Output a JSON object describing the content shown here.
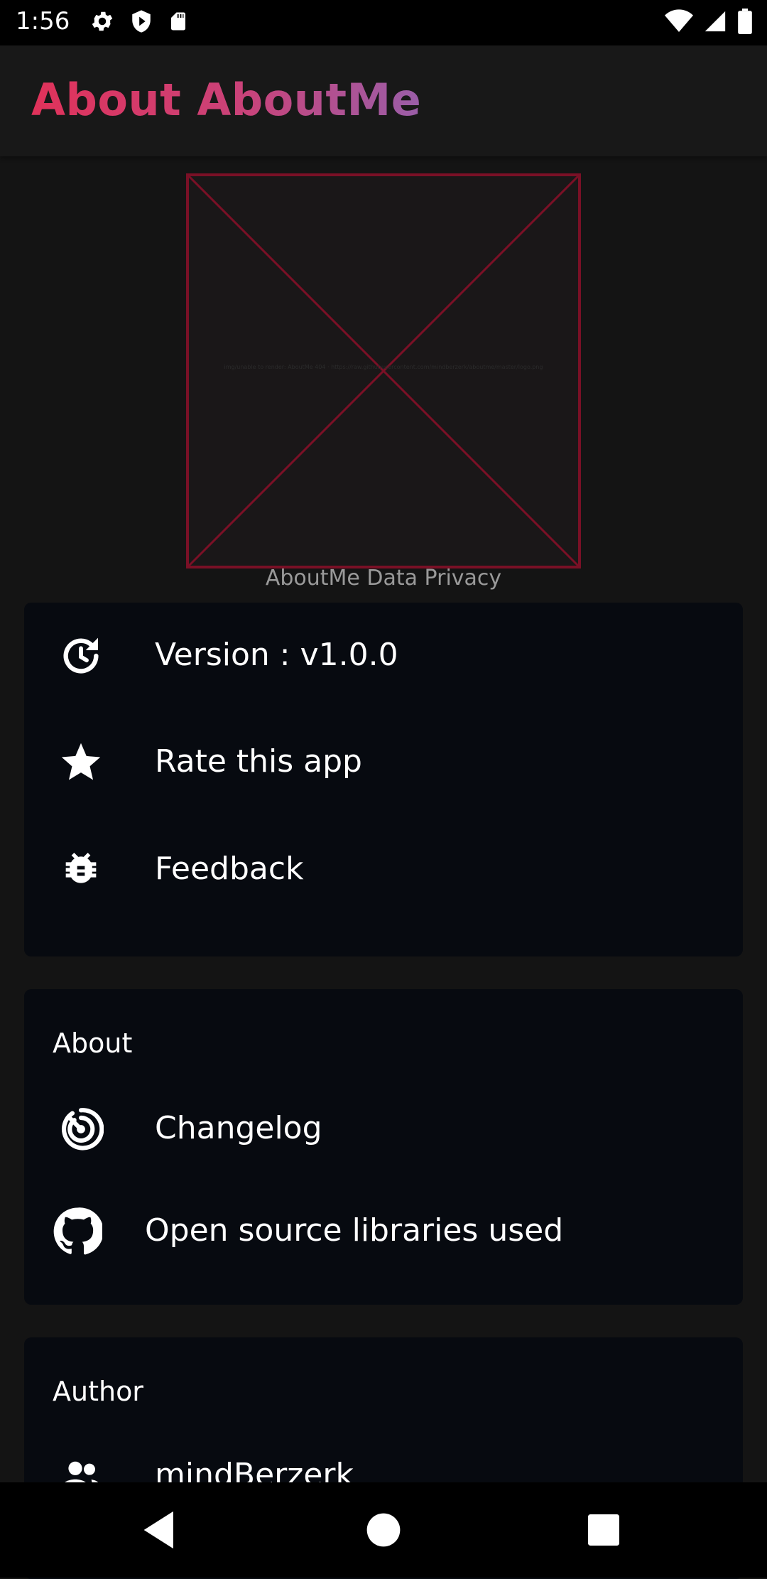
{
  "status_bar": {
    "time": "1:56",
    "left_icons": [
      "gear-icon",
      "shield-play-icon",
      "sd-card-icon"
    ],
    "right_icons": [
      "wifi-icon",
      "signal-icon",
      "battery-icon"
    ]
  },
  "app_bar": {
    "title": "About AboutMe",
    "title_gradient": [
      "#e0325a",
      "#9a5ea8"
    ]
  },
  "header": {
    "logo_alt": "img/unable to render: AboutMe 404 · https://raw.githubusercontent.com/mindberzerk/aboutme/master/logo.png",
    "privacy_link": "AboutMe Data Privacy"
  },
  "info_card": {
    "items": [
      {
        "icon": "update-icon",
        "label": "Version : v1.0.0"
      },
      {
        "icon": "star-icon",
        "label": "Rate this app"
      },
      {
        "icon": "bug-icon",
        "label": "Feedback"
      }
    ]
  },
  "about_card": {
    "title": "About",
    "items": [
      {
        "icon": "changelog-icon",
        "label": "Changelog"
      },
      {
        "icon": "github-icon",
        "label": "Open source libraries used"
      }
    ]
  },
  "author_card": {
    "title": "Author",
    "items": [
      {
        "icon": "people-icon",
        "label": "mindBerzerk"
      }
    ]
  },
  "nav_bar": {
    "buttons": [
      "back-icon",
      "home-icon",
      "recents-icon"
    ]
  },
  "colors": {
    "background": "#141414",
    "card": "#070a10",
    "placeholder_border": "#7a1026"
  }
}
